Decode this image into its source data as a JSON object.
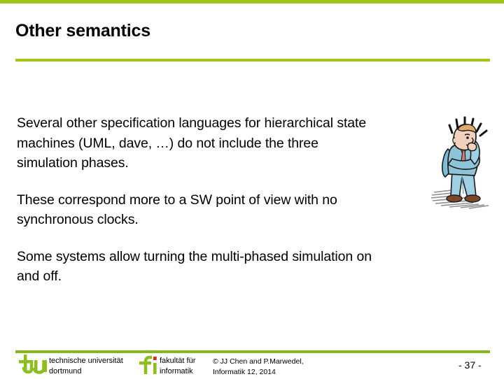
{
  "theme": {
    "accent_green": "#a2c617",
    "footer_green": "#86b81c",
    "text_color": "#000000",
    "background": "#ffffff"
  },
  "header": {
    "title": "Other semantics"
  },
  "main": {
    "paragraphs": [
      "Several other specification languages for hierarchical state machines (UML, dave, …) do not include the three simulation phases.",
      "These correspond more to a SW point of view with no synchronous clocks.",
      "Some systems allow turning the multi-phased simulation on and off."
    ]
  },
  "illustration": {
    "name": "thinking-man-cartoon",
    "description": "Cartoon man in blue suit resting chin on hand, thinking, with radiating idea lines around his head and a hatched shadow on the ground",
    "colors": {
      "suit": "#8fc4d8",
      "suit_shade": "#6aa9c4",
      "skin": "#f2d2bc",
      "hair": "#e0a96d",
      "tie": "#d9777c",
      "shoes": "#7a4a28",
      "shadow": "#8c8c8c",
      "outline": "#1a1a1a"
    }
  },
  "footer": {
    "tu_logo_text": "tu",
    "university_line1": "technische universität",
    "university_line2": "dortmund",
    "fi_logo_text": "fi",
    "faculty_line1": "fakultät für",
    "faculty_line2": "informatik",
    "copyright_line1": "© JJ Chen and  P.Marwedel,",
    "copyright_line2": "Informatik 12,  2014",
    "page_number": "-  37 -"
  }
}
